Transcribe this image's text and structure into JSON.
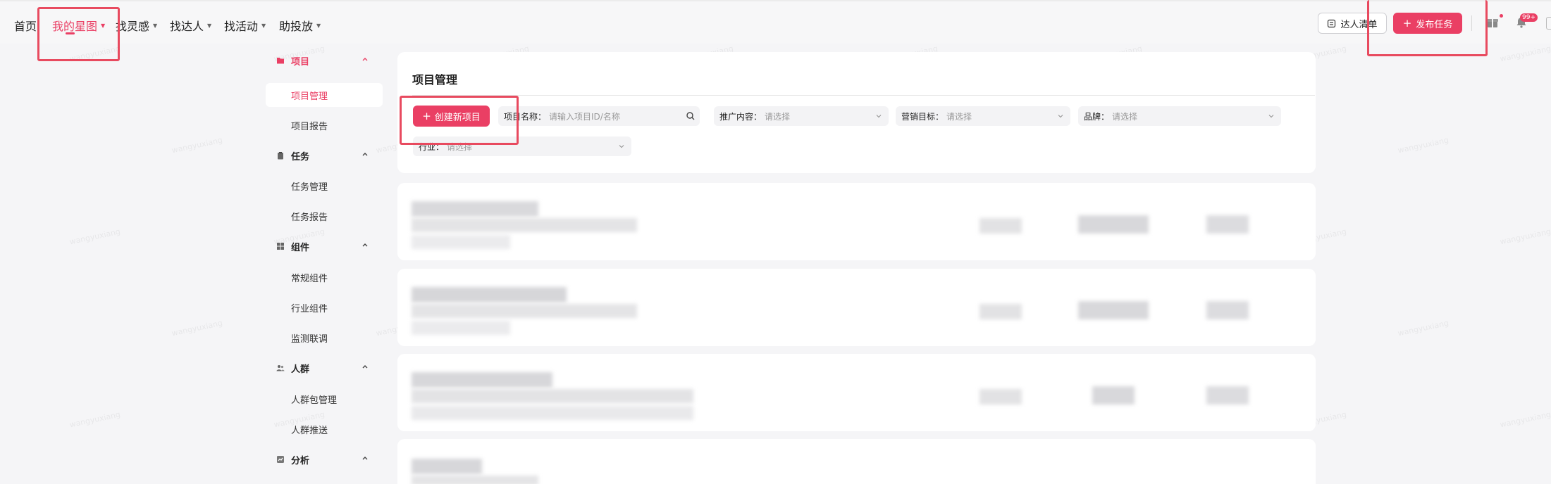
{
  "topnav": {
    "items": [
      {
        "label": "首页",
        "has_caret": false
      },
      {
        "label": "我的星图",
        "has_caret": true,
        "active": true
      },
      {
        "label": "找灵感",
        "has_caret": true
      },
      {
        "label": "找达人",
        "has_caret": true
      },
      {
        "label": "找活动",
        "has_caret": true
      },
      {
        "label": "助投放",
        "has_caret": true
      }
    ],
    "talent_list_label": "达人清单",
    "publish_task_label": "发布任务",
    "notification_badge": "99+"
  },
  "sidebar": {
    "groups": [
      {
        "label": "项目",
        "icon": "folder-icon",
        "items": [
          "项目管理",
          "项目报告"
        ]
      },
      {
        "label": "任务",
        "icon": "clipboard-icon",
        "items": [
          "任务管理",
          "任务报告"
        ]
      },
      {
        "label": "组件",
        "icon": "grid-icon",
        "items": [
          "常规组件",
          "行业组件",
          "监测联调"
        ]
      },
      {
        "label": "人群",
        "icon": "people-icon",
        "items": [
          "人群包管理",
          "人群推送"
        ]
      },
      {
        "label": "分析",
        "icon": "chart-icon",
        "items": []
      }
    ],
    "active_item": "项目管理"
  },
  "main": {
    "title": "项目管理",
    "create_button": "创建新项目",
    "filters": [
      {
        "label": "项目名称：",
        "placeholder": "请输入项目ID/名称",
        "type": "search"
      },
      {
        "label": "推广内容：",
        "placeholder": "请选择",
        "type": "select"
      },
      {
        "label": "营销目标：",
        "placeholder": "请选择",
        "type": "select"
      },
      {
        "label": "品牌：",
        "placeholder": "请选择",
        "type": "select"
      },
      {
        "label": "行业：",
        "placeholder": "请选择",
        "type": "select"
      }
    ]
  },
  "watermark": "wangyuxiang",
  "colors": {
    "accent": "#ea3f64",
    "annotation": "#e84a5f",
    "background": "#f5f5f7"
  }
}
